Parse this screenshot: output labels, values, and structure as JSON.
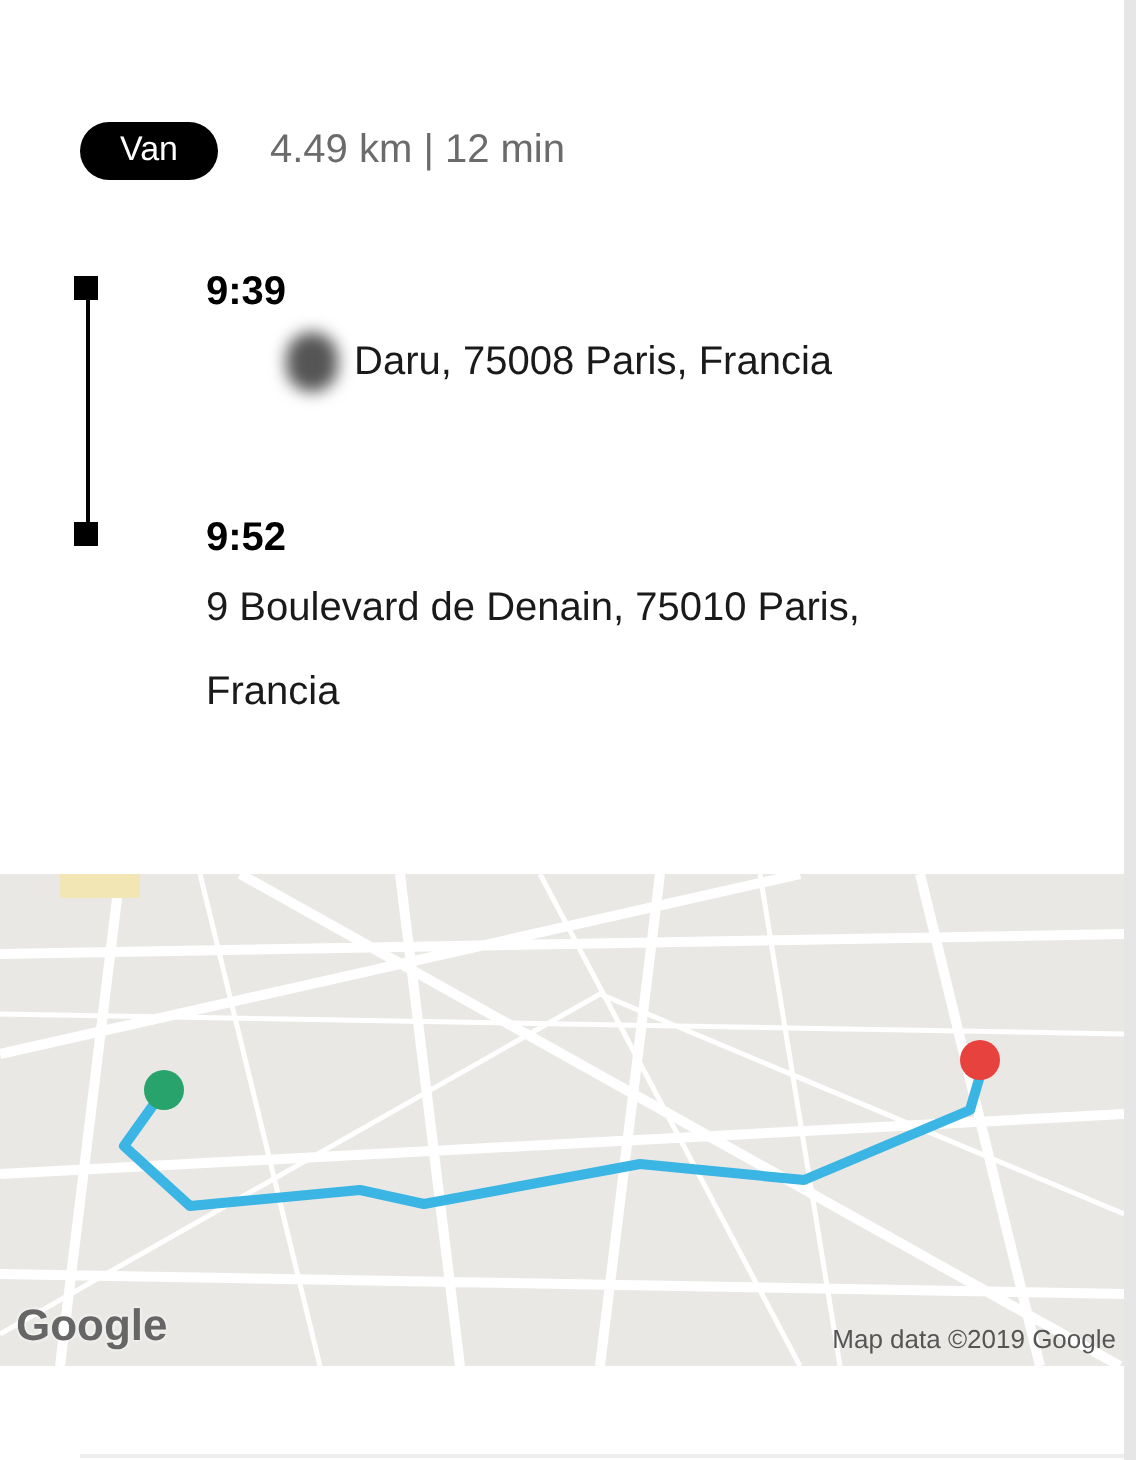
{
  "trip": {
    "vehicle": "Van",
    "summary": "4.49 km | 12 min"
  },
  "stops": [
    {
      "time": "9:39",
      "address": "Daru, 75008 Paris, Francia",
      "redacted": true
    },
    {
      "time": "9:52",
      "address": "9 Boulevard de Denain, 75010 Paris, Francia"
    }
  ],
  "map": {
    "logo": "Google",
    "attribution": "Map data ©2019 Google"
  }
}
